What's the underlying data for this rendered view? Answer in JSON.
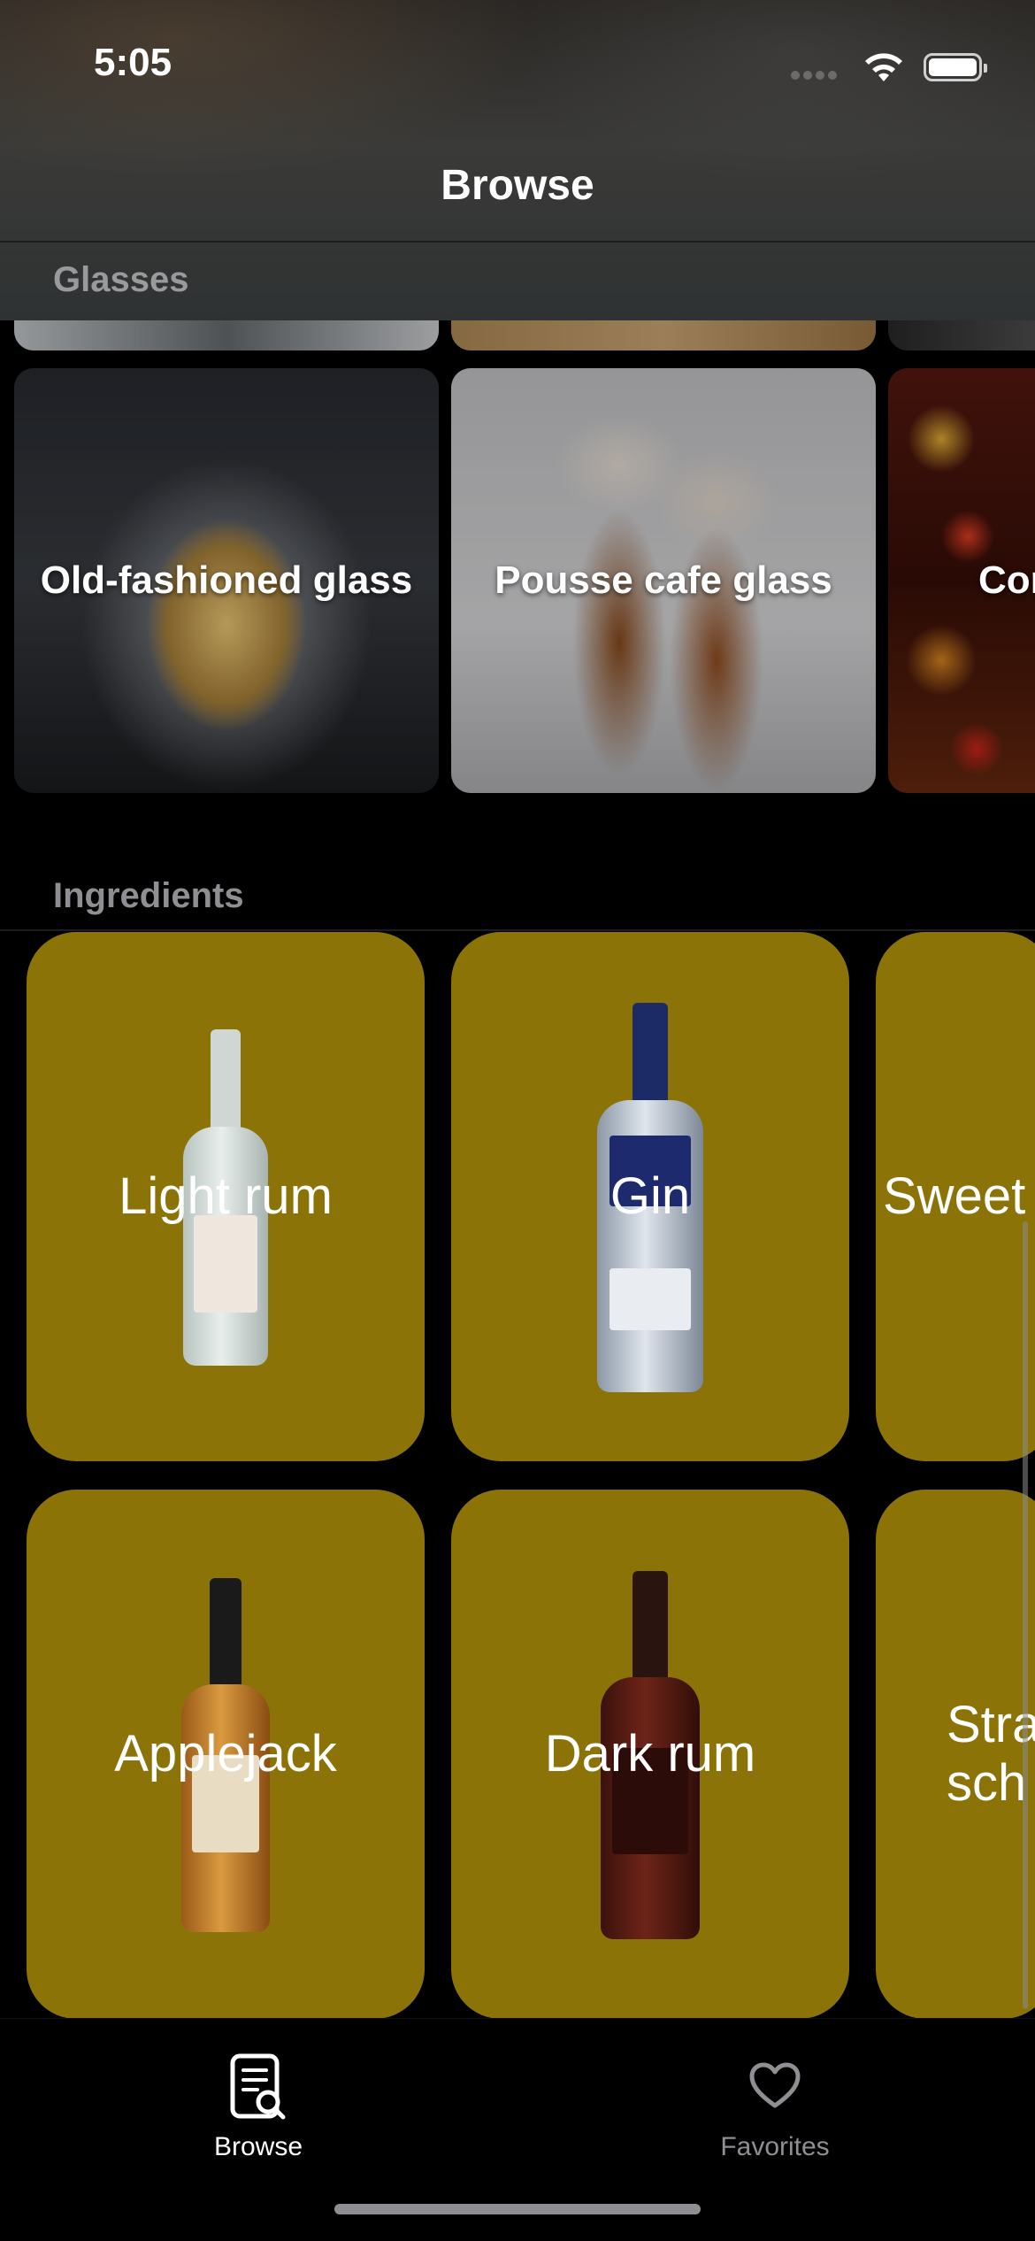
{
  "status_bar": {
    "time": "5:05"
  },
  "nav": {
    "title": "Browse"
  },
  "sections": {
    "glasses": {
      "title": "Glasses",
      "items": [
        {
          "label": "Old-fashioned glass"
        },
        {
          "label": "Pousse cafe glass"
        },
        {
          "label": "Cor"
        }
      ]
    },
    "ingredients": {
      "title": "Ingredients",
      "items": [
        {
          "label": "Light rum"
        },
        {
          "label": "Gin"
        },
        {
          "label": "Sweet"
        },
        {
          "label": "Applejack"
        },
        {
          "label": "Dark rum"
        },
        {
          "label": "Stra\nsch"
        }
      ]
    }
  },
  "tabs": [
    {
      "label": "Browse",
      "icon": "browse-document-search-icon",
      "selected": true
    },
    {
      "label": "Favorites",
      "icon": "heart-icon",
      "selected": false
    }
  ],
  "colors": {
    "ingredient_tile": "#8b7308",
    "background": "#000000",
    "secondary_text": "#8e8e93"
  }
}
